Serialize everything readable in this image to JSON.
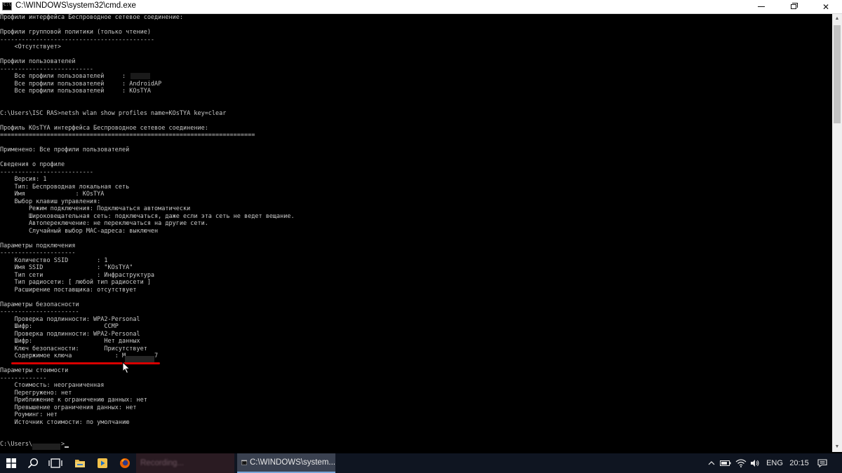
{
  "window": {
    "title": "C:\\WINDOWS\\system32\\cmd.exe"
  },
  "console": {
    "lines": [
      "Профили интерфейса Беспроводное сетевое соединение:",
      "",
      "Профили групповой политики (только чтение)",
      "-------------------------------------------",
      "    <Отсутствует>",
      "",
      "Профили пользователей",
      "--------------------------",
      "    Все профили пользователей     :",
      "    Все профили пользователей     : AndroidAP",
      "    Все профили пользователей     : KOsTYA",
      "",
      "",
      "C:\\Users\\ISC RAS>netsh wlan show profiles name=KOsTYA key=clear",
      "",
      "Профиль KOsTYA интерфейса Беспроводное сетевое соединение:",
      "=======================================================================",
      "",
      "Применено: Все профили пользователей",
      "",
      "Сведения о профиле",
      "--------------------------",
      "    Версия: 1",
      "    Тип: Беспроводная локальная сеть",
      "    Имя              : KOsTYA",
      "    Выбор клавиш управления:",
      "        Режим подключения: Подключаться автоматически",
      "        Широковещательная сеть: подключаться, даже если эта сеть не ведет вещание.",
      "        Автопереключение: не переключаться на другие сети.",
      "        Случайный выбор MAC-адреса: выключен",
      "",
      "Параметры подключения",
      "---------------------",
      "    Количество SSID        : 1",
      "    Имя SSID               : \"KOsTYA\"",
      "    Тип сети               : Инфраструктура",
      "    Тип радиосети: [ любой тип радиосети ]",
      "    Расширение поставщика: отсутствует",
      "",
      "Параметры безопасности",
      "----------------------",
      "    Проверка подлинности: WPA2-Personal",
      "    Шифр:                    CCMP",
      "    Проверка подлинности: WPA2-Personal",
      "    Шифр:                    Нет данных",
      "    Ключ безопасности:       Присутствует",
      "    Содержимое ключа            : M        7",
      "",
      "Параметры стоимости",
      "-------------",
      "    Стоимость: неограниченная",
      "    Перегружено: нет",
      "    Приближение к ограничению данных: нет",
      "    Превышение ограничения данных: нет",
      "    Роуминг: нет",
      "    Источник стоимости: по умолчанию",
      "",
      "",
      "C:\\Users\\        >"
    ]
  },
  "taskbar": {
    "start_icon": "windows-logo-icon",
    "search_icon": "magnifier-icon",
    "taskview_icon": "task-view-icon",
    "apps": [
      {
        "name": "file-explorer",
        "icon": "folder-icon"
      },
      {
        "name": "media-player",
        "icon": "media-icon"
      },
      {
        "name": "firefox",
        "icon": "firefox-icon"
      }
    ],
    "recording_label": "Recording...",
    "cmd_label": "C:\\WINDOWS\\system...",
    "tray": {
      "chevron": "^",
      "language": "ENG",
      "time": "20:15"
    }
  },
  "colors": {
    "console_bg": "#000000",
    "console_text": "#c8c8c8",
    "highlight_underline": "#d80000",
    "taskbar_bg": "#0f1521"
  }
}
